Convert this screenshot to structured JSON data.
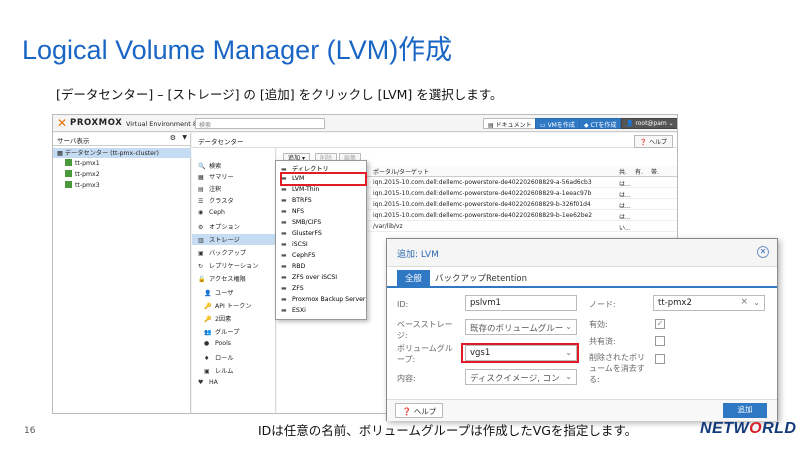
{
  "slide": {
    "title": "Logical Volume Manager (LVM)作成",
    "subtitle": "[データセンター] – [ストレージ] の [追加] をクリックし [LVM] を選択します。",
    "caption": "IDは任意の名前、ボリュームグループは作成したVGを指定します。",
    "page_number": "16",
    "logo_pre": "NETW",
    "logo_o": "O",
    "logo_post": "RLD"
  },
  "topbar": {
    "brand": "PROXMOX",
    "version": "Virtual Environment 8.3.0",
    "search_placeholder": "検索",
    "docs_label": "ドキュメント",
    "create_vm_label": "VMを作成",
    "create_ct_label": "CTを作成",
    "user_label": "root@pam"
  },
  "tree": {
    "view_label": "サーバ表示",
    "datacenter_label": "データセンター (tt-pmx-cluster)",
    "nodes": [
      "tt-pmx1",
      "tt-pmx2",
      "tt-pmx3"
    ]
  },
  "center": {
    "header": "データセンター",
    "help_label": "ヘルプ"
  },
  "menu": {
    "items": [
      {
        "icon": "search-icon",
        "glyph": "🔍",
        "label": "検索"
      },
      {
        "icon": "summary-icon",
        "glyph": "▦",
        "label": "サマリー"
      },
      {
        "icon": "notes-icon",
        "glyph": "▤",
        "label": "注釈"
      },
      {
        "icon": "cluster-icon",
        "glyph": "☰",
        "label": "クラスタ"
      },
      {
        "icon": "ceph-icon",
        "glyph": "◉",
        "label": "Ceph"
      },
      {
        "icon": "options-icon",
        "glyph": "⚙",
        "label": "オプション"
      },
      {
        "icon": "storage-icon",
        "glyph": "▥",
        "label": "ストレージ"
      },
      {
        "icon": "backup-icon",
        "glyph": "▣",
        "label": "バックアップ"
      },
      {
        "icon": "replication-icon",
        "glyph": "↻",
        "label": "レプリケーション"
      },
      {
        "icon": "permissions-icon",
        "glyph": "🔓",
        "label": "アクセス権限"
      }
    ],
    "sub_items": [
      {
        "icon": "user-icon",
        "glyph": "👤",
        "label": "ユーザ"
      },
      {
        "icon": "api-token-icon",
        "glyph": "🔑",
        "label": "API トークン"
      },
      {
        "icon": "two-factor-icon",
        "glyph": "🔑",
        "label": "2因素"
      },
      {
        "icon": "group-icon",
        "glyph": "👥",
        "label": "グループ"
      },
      {
        "icon": "pools-icon",
        "glyph": "●",
        "label": "Pools"
      },
      {
        "icon": "role-icon",
        "glyph": "♦",
        "label": "ロール"
      },
      {
        "icon": "realm-icon",
        "glyph": "▣",
        "label": "レルム"
      }
    ],
    "ha_label": "HA"
  },
  "content": {
    "add_label": "追加",
    "remove_label": "削除",
    "edit_label": "編集",
    "col_target": "ポータル/ターゲット",
    "col_shared": "共.",
    "col_enabled": "有.",
    "col_bandwidth": "帯.",
    "rows": [
      {
        "target": "iqn.2015-10.com.dell:dellemc-powerstore-de402202608829-a-56ad6cb3",
        "shared": "は..."
      },
      {
        "target": "iqn.2015-10.com.dell:dellemc-powerstore-de402202608829-a-1eeac97b",
        "shared": "は..."
      },
      {
        "target": "iqn.2015-10.com.dell:dellemc-powerstore-de402202608829-b-326f01d4",
        "shared": "は..."
      },
      {
        "target": "iqn.2015-10.com.dell:dellemc-powerstore-de402202608829-b-1ee62be2",
        "shared": "は..."
      },
      {
        "target": "/var/lib/vz",
        "shared": "い..."
      }
    ]
  },
  "dropdown": {
    "items": [
      {
        "icon": "folder-icon",
        "glyph": "▬",
        "label": "ディレクトリ"
      },
      {
        "icon": "lvm-icon",
        "glyph": "▬",
        "label": "LVM"
      },
      {
        "icon": "lvm-thin-icon",
        "glyph": "▬",
        "label": "LVM-Thin"
      },
      {
        "icon": "btrfs-icon",
        "glyph": "▬",
        "label": "BTRFS"
      },
      {
        "icon": "nfs-icon",
        "glyph": "▬",
        "label": "NFS"
      },
      {
        "icon": "smb-icon",
        "glyph": "▬",
        "label": "SMB/CIFS"
      },
      {
        "icon": "glusterfs-icon",
        "glyph": "▬",
        "label": "GlusterFS"
      },
      {
        "icon": "iscsi-icon",
        "glyph": "▬",
        "label": "iSCSI"
      },
      {
        "icon": "cephfs-icon",
        "glyph": "▬",
        "label": "CephFS"
      },
      {
        "icon": "rbd-icon",
        "glyph": "▬",
        "label": "RBD"
      },
      {
        "icon": "zfs-iscsi-icon",
        "glyph": "▬",
        "label": "ZFS over iSCSI"
      },
      {
        "icon": "zfs-icon",
        "glyph": "▬",
        "label": "ZFS"
      },
      {
        "icon": "pbs-icon",
        "glyph": "▬",
        "label": "Proxmox Backup Server"
      },
      {
        "icon": "esxi-icon",
        "glyph": "▬",
        "label": "ESXi"
      }
    ]
  },
  "dialog": {
    "title": "追加: LVM",
    "tab_general": "全般",
    "tab_backup": "バックアップRetention",
    "id_label": "ID:",
    "id_value": "pslvm1",
    "base_storage_label_1": "ベースストレー",
    "base_storage_label_2": "ジ:",
    "base_storage_value": "既存のボリュームグルー",
    "vg_label_1": "ボリュームグル",
    "vg_label_2": "ープ:",
    "vg_value": "vgs1",
    "content_label": "内容:",
    "content_value": "ディスクイメージ, コン",
    "node_label": "ノード:",
    "node_value": "tt-pmx2",
    "enabled_label": "有効:",
    "shared_label": "共有済:",
    "wipe_label_1": "削除されたボリ",
    "wipe_label_2": "ュームを消去す",
    "wipe_label_3": "る:",
    "help_label": "ヘルプ",
    "add_label": "追加"
  },
  "colors": {
    "title_blue": "#1a66c4",
    "proxmox_orange": "#e57000",
    "accent_blue": "#2f78c4",
    "highlight_red": "#e11c24"
  }
}
